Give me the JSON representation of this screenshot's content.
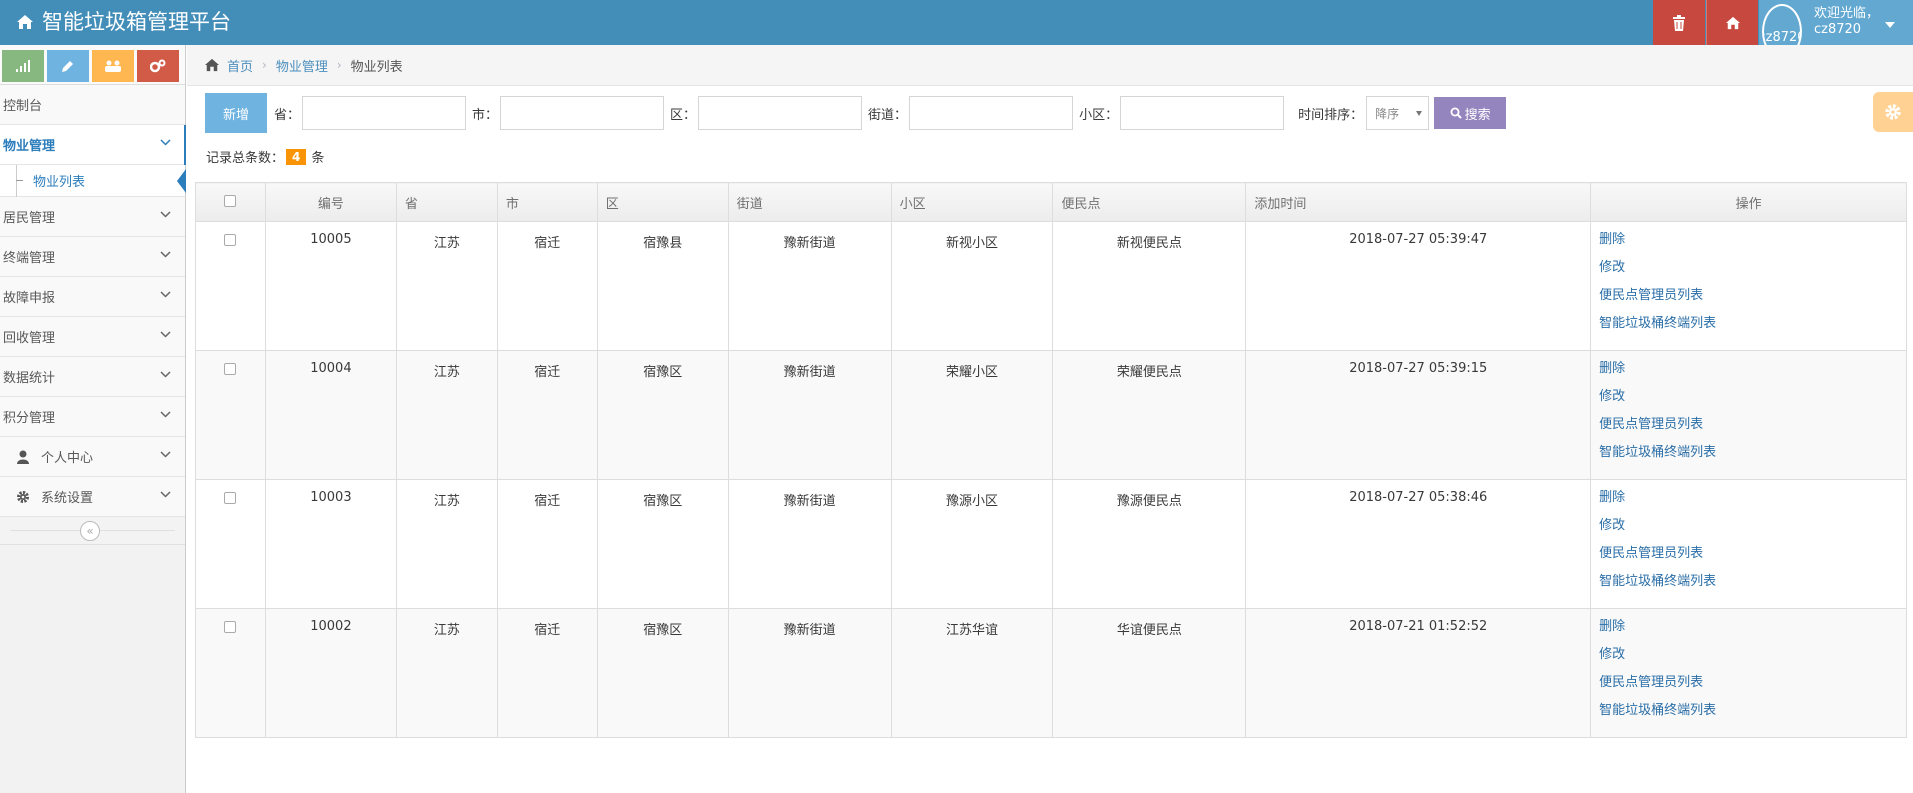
{
  "app": {
    "title": "智能垃圾箱管理平台"
  },
  "user": {
    "avatar_alt": "cz8720",
    "greeting": "欢迎光临，",
    "name": "cz8720"
  },
  "sidebar": {
    "items": [
      {
        "label": "控制台"
      },
      {
        "label": "物业管理"
      },
      {
        "label": "物业列表"
      },
      {
        "label": "居民管理"
      },
      {
        "label": "终端管理"
      },
      {
        "label": "故障申报"
      },
      {
        "label": "回收管理"
      },
      {
        "label": "数据统计"
      },
      {
        "label": "积分管理"
      },
      {
        "label": "个人中心"
      },
      {
        "label": "系统设置"
      }
    ],
    "collapse_glyph": "«"
  },
  "breadcrumb": {
    "home": "首页",
    "section": "物业管理",
    "current": "物业列表",
    "sep": "›"
  },
  "search": {
    "add_label": "新增",
    "province_label": "省：",
    "city_label": "市：",
    "district_label": "区：",
    "street_label": "街道：",
    "community_label": "小区：",
    "sort_label": "时间排序：",
    "sort_value": "降序",
    "search_label": "搜索"
  },
  "records": {
    "prefix": "记录总条数：",
    "count": "4",
    "suffix": "条"
  },
  "colors": {
    "navbar": "#438eb9",
    "add": "#6fb3e0",
    "search": "#9585bf",
    "badge": "#f89406"
  },
  "table": {
    "headers": [
      "编号",
      "省",
      "市",
      "区",
      "街道",
      "小区",
      "便民点",
      "添加时间",
      "操作"
    ],
    "ops": [
      "删除",
      "修改",
      "便民点管理员列表",
      "智能垃圾桶终端列表"
    ],
    "rows": [
      [
        "10005",
        "江苏",
        "宿迁",
        "宿豫县",
        "豫新街道",
        "新视小区",
        "新视便民点",
        "2018-07-27 05:39:47"
      ],
      [
        "10004",
        "江苏",
        "宿迁",
        "宿豫区",
        "豫新街道",
        "荣耀小区",
        "荣耀便民点",
        "2018-07-27 05:39:15"
      ],
      [
        "10003",
        "江苏",
        "宿迁",
        "宿豫区",
        "豫新街道",
        "豫源小区",
        "豫源便民点",
        "2018-07-27 05:38:46"
      ],
      [
        "10002",
        "江苏",
        "宿迁",
        "宿豫区",
        "豫新街道",
        "江苏华谊",
        "华谊便民点",
        "2018-07-21 01:52:52"
      ]
    ]
  }
}
